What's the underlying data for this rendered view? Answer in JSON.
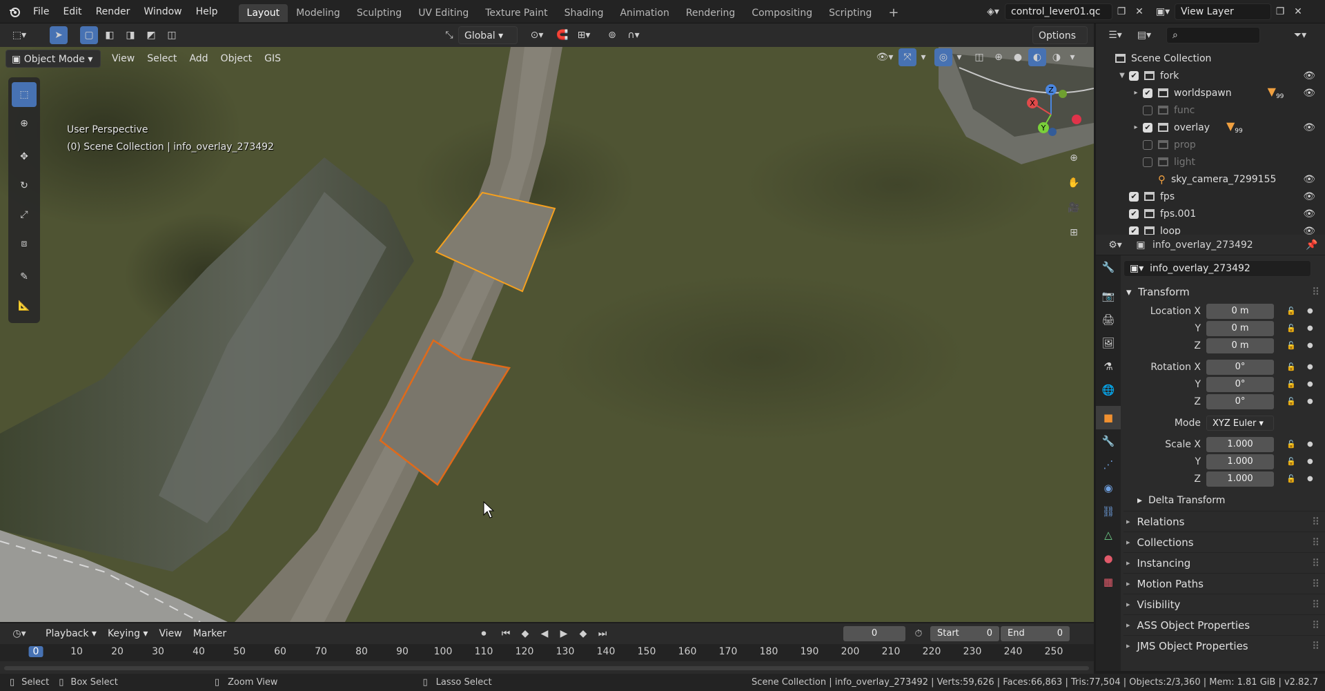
{
  "topbar": {
    "menus": [
      "File",
      "Edit",
      "Render",
      "Window",
      "Help"
    ],
    "workspaces": [
      "Layout",
      "Modeling",
      "Sculpting",
      "UV Editing",
      "Texture Paint",
      "Shading",
      "Animation",
      "Rendering",
      "Compositing",
      "Scripting"
    ],
    "active_workspace": "Layout",
    "scene_name": "control_lever01.qc",
    "view_layer": "View Layer",
    "plus": "+"
  },
  "viewport_header": {
    "transform_orientation": "Global",
    "options": "Options",
    "mode": "Object Mode",
    "menus": [
      "View",
      "Select",
      "Add",
      "Object",
      "GIS"
    ]
  },
  "viewport": {
    "perspective": "User Perspective",
    "context": "(0) Scene Collection | info_overlay_273492",
    "axes": {
      "x": "X",
      "y": "Y",
      "z": "Z"
    }
  },
  "outliner": {
    "root": "Scene Collection",
    "items": [
      {
        "name": "fork",
        "checked": true,
        "expand": "▼",
        "indent": 0,
        "eye": true
      },
      {
        "name": "worldspawn",
        "checked": true,
        "expand": "▸",
        "indent": 1,
        "eye": true,
        "badge": "99"
      },
      {
        "name": "func",
        "checked": false,
        "expand": "",
        "indent": 1,
        "eye": false
      },
      {
        "name": "overlay",
        "checked": true,
        "expand": "▸",
        "indent": 1,
        "eye": true,
        "badge": "99"
      },
      {
        "name": "prop",
        "checked": false,
        "expand": "",
        "indent": 1,
        "eye": false
      },
      {
        "name": "light",
        "checked": false,
        "expand": "",
        "indent": 1,
        "eye": false
      },
      {
        "name": "sky_camera_7299155",
        "checked": null,
        "expand": "",
        "indent": 1,
        "eye": true
      },
      {
        "name": "fps",
        "checked": true,
        "expand": "",
        "indent": 0,
        "eye": true
      },
      {
        "name": "fps.001",
        "checked": true,
        "expand": "",
        "indent": 0,
        "eye": true
      },
      {
        "name": "loop",
        "checked": true,
        "expand": "",
        "indent": 0,
        "eye": true
      }
    ]
  },
  "properties": {
    "object_name": "info_overlay_273492",
    "datablock_name": "info_overlay_273492",
    "transform_label": "Transform",
    "location": {
      "label_x": "Location X",
      "label_y": "Y",
      "label_z": "Z",
      "x": "0 m",
      "y": "0 m",
      "z": "0 m"
    },
    "rotation": {
      "label_x": "Rotation X",
      "label_y": "Y",
      "label_z": "Z",
      "x": "0°",
      "y": "0°",
      "z": "0°"
    },
    "mode_label": "Mode",
    "mode_value": "XYZ Euler",
    "scale": {
      "label_x": "Scale X",
      "label_y": "Y",
      "label_z": "Z",
      "x": "1.000",
      "y": "1.000",
      "z": "1.000"
    },
    "delta_transform": "Delta Transform",
    "panels": [
      "Relations",
      "Collections",
      "Instancing",
      "Motion Paths",
      "Visibility",
      "ASS Object Properties",
      "JMS Object Properties"
    ]
  },
  "timeline": {
    "menus": [
      "Playback",
      "Keying",
      "View",
      "Marker"
    ],
    "current_frame": "0",
    "start_label": "Start",
    "start": "0",
    "end_label": "End",
    "end": "0",
    "ticks": [
      "0",
      "10",
      "20",
      "30",
      "40",
      "50",
      "60",
      "70",
      "80",
      "90",
      "100",
      "110",
      "120",
      "130",
      "140",
      "150",
      "160",
      "170",
      "180",
      "190",
      "200",
      "210",
      "220",
      "230",
      "240",
      "250"
    ]
  },
  "statusbar": {
    "select": "Select",
    "box_select": "Box Select",
    "zoom_view": "Zoom View",
    "lasso_select": "Lasso Select",
    "stats": "Scene Collection | info_overlay_273492 | Verts:59,626 | Faces:66,863 | Tris:77,504 | Objects:2/3,360 | Mem: 1.81 GiB | v2.82.7"
  },
  "colors": {
    "accent": "#4772b3",
    "selection_outline": "#f58a1f",
    "active_outline": "#e0701a",
    "grass": "#4c5130",
    "road": "#7a766c"
  }
}
